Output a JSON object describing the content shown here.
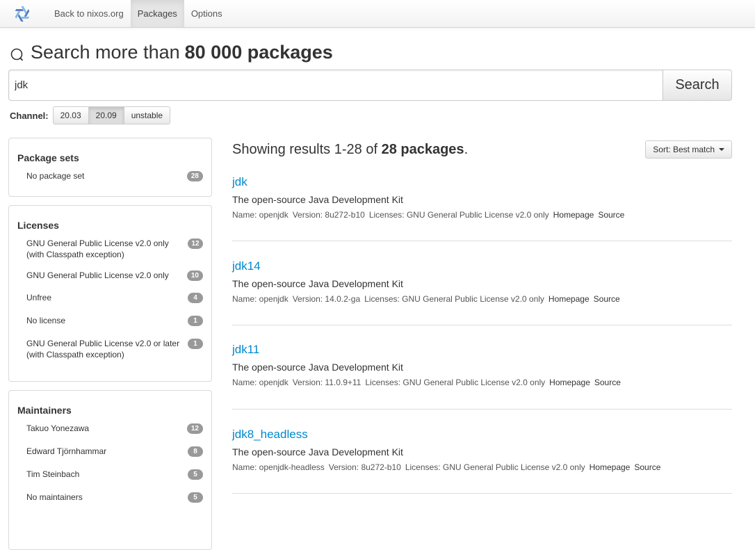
{
  "nav": {
    "items": [
      {
        "label": "Back to nixos.org",
        "active": false
      },
      {
        "label": "Packages",
        "active": true
      },
      {
        "label": "Options",
        "active": false
      }
    ]
  },
  "header": {
    "title_prefix": "Search more than",
    "title_bold": "80 000 packages"
  },
  "search": {
    "value": "jdk",
    "placeholder": "",
    "button_label": "Search"
  },
  "channel": {
    "label": "Channel:",
    "options": [
      "20.03",
      "20.09",
      "unstable"
    ],
    "selected": "20.09"
  },
  "sidebar": {
    "package_sets": {
      "title": "Package sets",
      "items": [
        {
          "label": "No package set",
          "count": "28"
        }
      ]
    },
    "licenses": {
      "title": "Licenses",
      "items": [
        {
          "label": "GNU General Public License v2.0 only (with Classpath exception)",
          "count": "12"
        },
        {
          "label": "GNU General Public License v2.0 only",
          "count": "10"
        },
        {
          "label": "Unfree",
          "count": "4"
        },
        {
          "label": "No license",
          "count": "1"
        },
        {
          "label": "GNU General Public License v2.0 or later (with Classpath exception)",
          "count": "1"
        }
      ]
    },
    "maintainers": {
      "title": "Maintainers",
      "items": [
        {
          "label": "Takuo Yonezawa",
          "count": "12"
        },
        {
          "label": "Edward Tjörnhammar",
          "count": "8"
        },
        {
          "label": "Tim Steinbach",
          "count": "5"
        },
        {
          "label": "No maintainers",
          "count": "5"
        }
      ]
    }
  },
  "results": {
    "summary_prefix": "Showing results 1-28 of",
    "summary_bold": "28 packages",
    "summary_suffix": ".",
    "sort_label": "Sort: Best match",
    "packages": [
      {
        "name": "jdk",
        "description": "The open-source Java Development Kit",
        "meta_name": "Name: openjdk",
        "meta_version": "Version: 8u272-b10",
        "meta_licenses": "Licenses: GNU General Public License v2.0 only",
        "homepage": "Homepage",
        "source": "Source"
      },
      {
        "name": "jdk14",
        "description": "The open-source Java Development Kit",
        "meta_name": "Name: openjdk",
        "meta_version": "Version: 14.0.2-ga",
        "meta_licenses": "Licenses: GNU General Public License v2.0 only",
        "homepage": "Homepage",
        "source": "Source"
      },
      {
        "name": "jdk11",
        "description": "The open-source Java Development Kit",
        "meta_name": "Name: openjdk",
        "meta_version": "Version: 11.0.9+11",
        "meta_licenses": "Licenses: GNU General Public License v2.0 only",
        "homepage": "Homepage",
        "source": "Source"
      },
      {
        "name": "jdk8_headless",
        "description": "The open-source Java Development Kit",
        "meta_name": "Name: openjdk-headless",
        "meta_version": "Version: 8u272-b10",
        "meta_licenses": "Licenses: GNU General Public License v2.0 only",
        "homepage": "Homepage",
        "source": "Source"
      }
    ]
  },
  "colors": {
    "link": "#0088cc",
    "badge": "#999999",
    "logo_dark": "#5277c3",
    "logo_light": "#7ebae4"
  }
}
